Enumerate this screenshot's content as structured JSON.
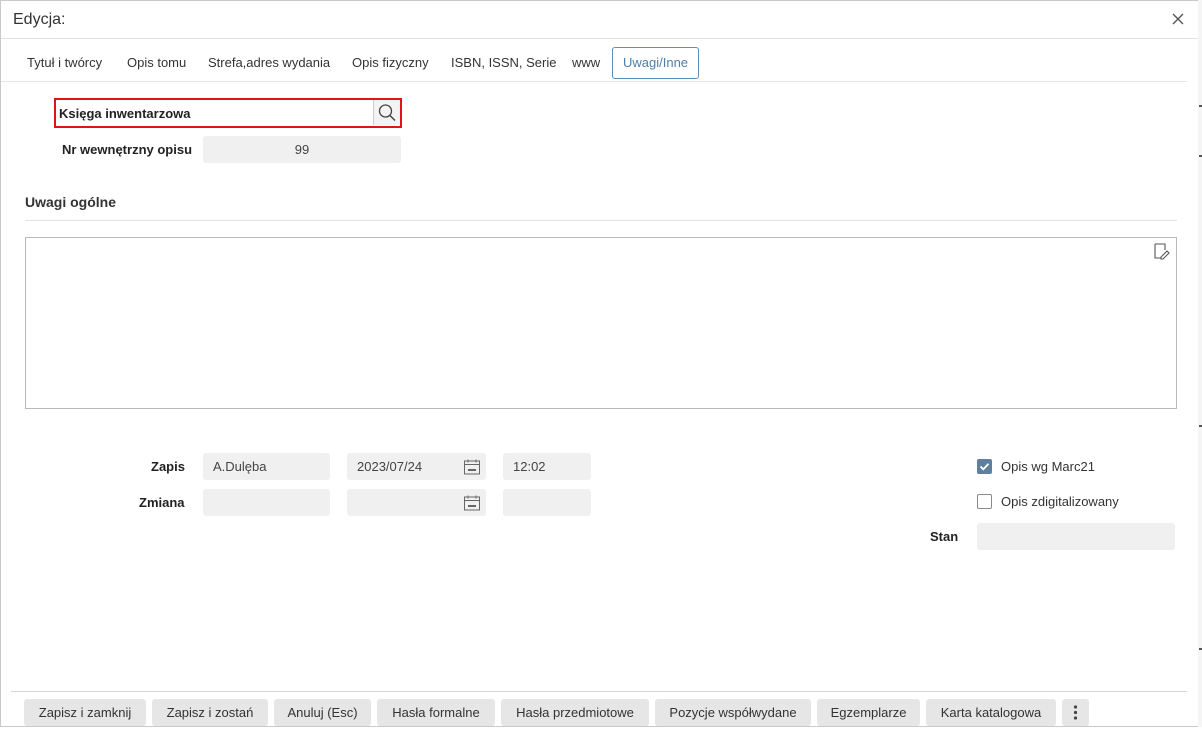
{
  "dialog": {
    "title": "Edycja:"
  },
  "tabs": [
    {
      "label": "Tytuł i twórcy"
    },
    {
      "label": "Opis tomu"
    },
    {
      "label": "Strefa,adres wydania"
    },
    {
      "label": "Opis fizyczny"
    },
    {
      "label": "ISBN, ISSN, Serie"
    },
    {
      "label": "www"
    },
    {
      "label": "Uwagi/Inne",
      "active": true
    }
  ],
  "fields": {
    "ksiega_label": "Księga inwentarzowa",
    "ksiega_value": "",
    "nr_label": "Nr wewnętrzny opisu",
    "nr_value": "99"
  },
  "notes": {
    "section_title": "Uwagi ogólne",
    "text": ""
  },
  "record": {
    "zapis_label": "Zapis",
    "zapis_user": "A.Dulęba",
    "zapis_date": "2023/07/24",
    "zapis_time": "12:02",
    "zmiana_label": "Zmiana",
    "zmiana_user": "",
    "zmiana_date": "",
    "zmiana_time": ""
  },
  "options": {
    "marc21_label": "Opis wg Marc21",
    "marc21_checked": true,
    "digital_label": "Opis zdigitalizowany",
    "digital_checked": false,
    "stan_label": "Stan",
    "stan_value": ""
  },
  "buttons": [
    "Zapisz i zamknij",
    "Zapisz i zostań",
    "Anuluj (Esc)",
    "Hasła formalne",
    "Hasła przedmiotowe",
    "Pozycje współwydane",
    "Egzemplarze",
    "Karta katalogowa"
  ],
  "colors": {
    "accent": "#5f8fb6",
    "highlight": "#e0131a",
    "field_bg": "#f0f0f0",
    "checkbox_on": "#5f7f9f"
  }
}
